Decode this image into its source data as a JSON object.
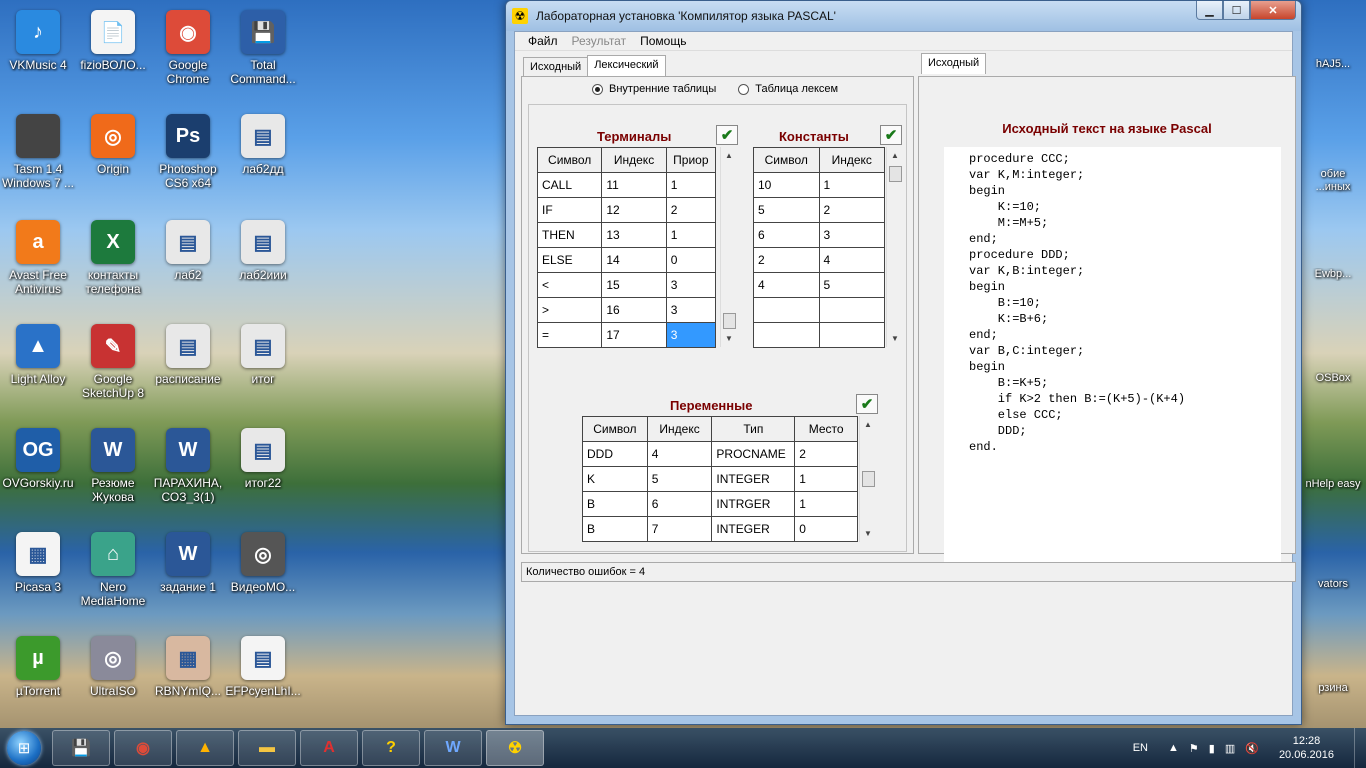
{
  "desktop_icons": [
    {
      "label": "VKMusic 4",
      "color": "#2a8ae0",
      "glyph": "♪"
    },
    {
      "label": "fizioВОЛО...",
      "color": "#f4f4f4",
      "glyph": "📄"
    },
    {
      "label": "Google Chrome",
      "color": "#dd4b39",
      "glyph": "◉"
    },
    {
      "label": "Total Command...",
      "color": "#2d5fa8",
      "glyph": "💾"
    },
    {
      "label": "Tasm 1.4 Windows 7 ...",
      "color": "#444444",
      "glyph": ""
    },
    {
      "label": "Origin",
      "color": "#f06a1a",
      "glyph": "◎"
    },
    {
      "label": "Photoshop CS6 x64",
      "color": "#1b3e6e",
      "glyph": "Ps"
    },
    {
      "label": "лаб2дд",
      "color": "#e8e8e8",
      "glyph": "▤"
    },
    {
      "label": "Avast Free Antivirus",
      "color": "#f27a1a",
      "glyph": "a"
    },
    {
      "label": "контакты телефона",
      "color": "#1d7a3d",
      "glyph": "X"
    },
    {
      "label": "лаб2",
      "color": "#e8e8e8",
      "glyph": "▤"
    },
    {
      "label": "лаб2иии",
      "color": "#e8e8e8",
      "glyph": "▤"
    },
    {
      "label": "Light Alloy",
      "color": "#2a72c8",
      "glyph": "▲"
    },
    {
      "label": "Google SketchUp 8",
      "color": "#c83232",
      "glyph": "✎"
    },
    {
      "label": "расписание",
      "color": "#e8e8e8",
      "glyph": "▤"
    },
    {
      "label": "итог",
      "color": "#e8e8e8",
      "glyph": "▤"
    },
    {
      "label": "OVGorskiy.ru",
      "color": "#1f5ea8",
      "glyph": "OG"
    },
    {
      "label": "Резюме Жукова",
      "color": "#2b5797",
      "glyph": "W"
    },
    {
      "label": "ПАРАХИНА, СОЗ_3(1)",
      "color": "#2b5797",
      "glyph": "W"
    },
    {
      "label": "итог22",
      "color": "#e8e8e8",
      "glyph": "▤"
    },
    {
      "label": "Picasa 3",
      "color": "#f4f4f4",
      "glyph": "▦"
    },
    {
      "label": "Nero MediaHome",
      "color": "#3aa38a",
      "glyph": "⌂"
    },
    {
      "label": "задание 1",
      "color": "#2b5797",
      "glyph": "W"
    },
    {
      "label": "ВидеоМО...",
      "color": "#555555",
      "glyph": "◎"
    },
    {
      "label": "µTorrent",
      "color": "#3c9a2c",
      "glyph": "µ"
    },
    {
      "label": "UltraISO",
      "color": "#8a8a9a",
      "glyph": "◎"
    },
    {
      "label": "RBNYmIQ...",
      "color": "#d8b8a0",
      "glyph": "▦"
    },
    {
      "label": "EFPcyenLhI...",
      "color": "#f4f4f4",
      "glyph": "▤"
    }
  ],
  "right_edge_labels": [
    "hAJ5...",
    "обие ...иных",
    "Ewbp...",
    "OSBox",
    "nHelp easy",
    "vators",
    "рзина"
  ],
  "window": {
    "title": "Лабораторная установка 'Компилятор языка PASCAL'",
    "menu": [
      "Файл",
      "Результат",
      "Помощь"
    ],
    "left_tabs": [
      "Исходный",
      "Лексический"
    ],
    "right_tabs": [
      "Исходный"
    ],
    "radio": {
      "option1": "Внутренние таблицы",
      "option2": "Таблица лексем"
    },
    "terminals": {
      "title": "Терминалы",
      "headers": [
        "Символ",
        "Индекс",
        "Приор"
      ],
      "rows": [
        [
          "CALL",
          "11",
          "1"
        ],
        [
          "IF",
          "12",
          "2"
        ],
        [
          "THEN",
          "13",
          "1"
        ],
        [
          "ELSE",
          "14",
          "0"
        ],
        [
          "<",
          "15",
          "3"
        ],
        [
          ">",
          "16",
          "3"
        ],
        [
          "=",
          "17",
          "3"
        ]
      ]
    },
    "constants": {
      "title": "Константы",
      "headers": [
        "Символ",
        "Индекс"
      ],
      "rows": [
        [
          "10",
          "1"
        ],
        [
          "5",
          "2"
        ],
        [
          "6",
          "3"
        ],
        [
          "2",
          "4"
        ],
        [
          "4",
          "5"
        ],
        [
          "",
          ""
        ],
        [
          "",
          ""
        ]
      ]
    },
    "variables": {
      "title": "Переменные",
      "headers": [
        "Символ",
        "Индекс",
        "Тип",
        "Место"
      ],
      "rows": [
        [
          "DDD",
          "4",
          "PROCNAME",
          "2"
        ],
        [
          "K",
          "5",
          "INTEGER",
          "1"
        ],
        [
          "B",
          "6",
          "INTRGER",
          "1"
        ],
        [
          "B",
          "7",
          "INTEGER",
          "0"
        ]
      ]
    },
    "source_title": "Исходный текст на языке Pascal",
    "source_code": "procedure CCC;\nvar K,M:integer;\nbegin\n    K:=10;\n    M:=M+5;\nend;\nprocedure DDD;\nvar K,B:integer;\nbegin\n    B:=10;\n    K:=B+6;\nend;\nvar B,C:integer;\nbegin\n    B:=K+5;\n    if K>2 then B:=(K+5)-(K+4)\n    else CCC;\n    DDD;\nend.",
    "status": "Количество ошибок = 4"
  },
  "taskbar": {
    "lang": "EN",
    "time": "12:28",
    "date": "20.06.2016"
  }
}
